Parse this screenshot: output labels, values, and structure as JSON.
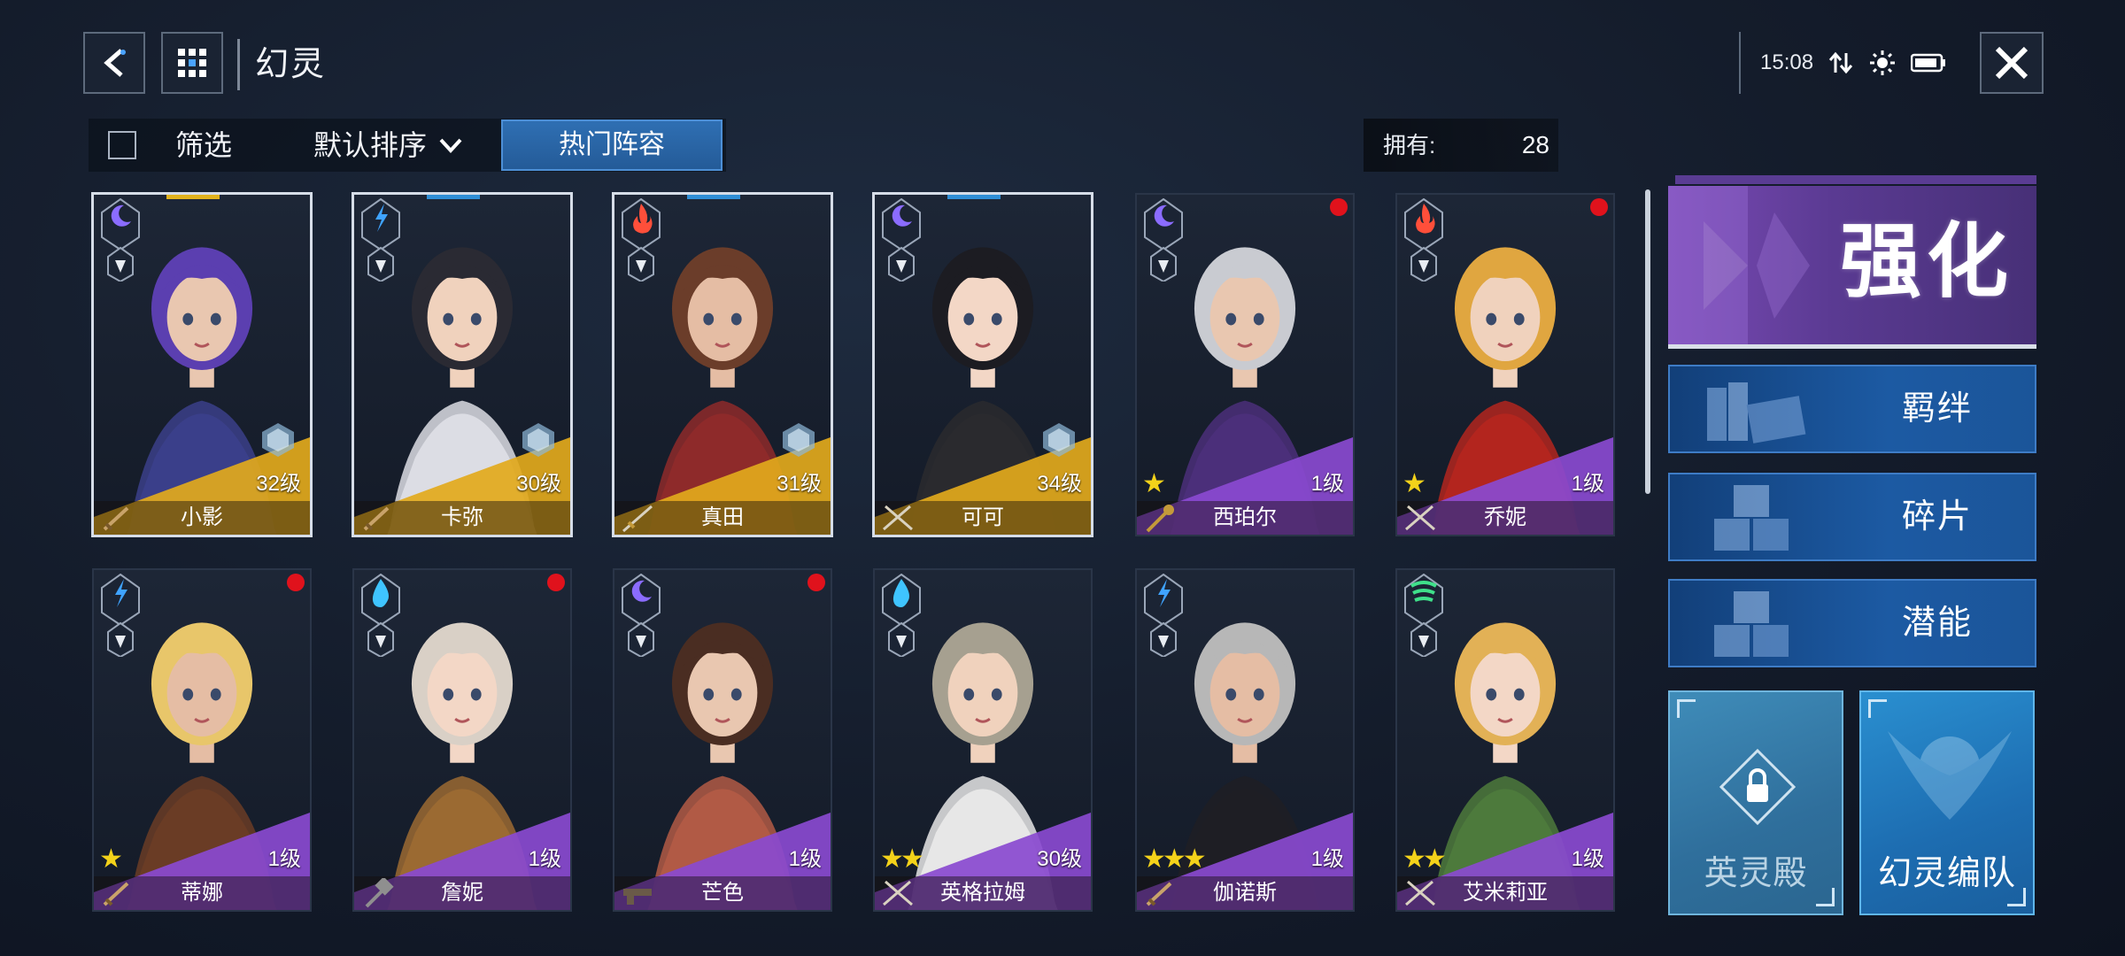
{
  "header": {
    "title": "幻灵",
    "back_icon": "back-arrow-icon",
    "grid_icon": "grid-menu-icon",
    "close_icon": "close-icon",
    "time": "15:08"
  },
  "toolbar": {
    "filter_label": "筛选",
    "sort_label": "默认排序",
    "hot_lineup_label": "热门阵容",
    "owned_label": "拥有:",
    "owned_count": "28"
  },
  "characters": [
    {
      "name": "小影",
      "level": "32级",
      "element": "moon",
      "weapon": "dagger",
      "stars": 0,
      "rarity": "gold",
      "selected": true,
      "alert": false,
      "accent": "#e2b21d"
    },
    {
      "name": "卡弥",
      "level": "30级",
      "element": "lightning",
      "weapon": "dagger",
      "stars": 0,
      "rarity": "gold",
      "selected": true,
      "alert": false,
      "accent": "#2f8ed6"
    },
    {
      "name": "真田",
      "level": "31级",
      "element": "fire",
      "weapon": "sword",
      "stars": 0,
      "rarity": "gold",
      "selected": true,
      "alert": false,
      "accent": "#2f8ed6"
    },
    {
      "name": "可可",
      "level": "34级",
      "element": "moon",
      "weapon": "crossed-swords",
      "stars": 0,
      "rarity": "gold",
      "selected": true,
      "alert": false,
      "accent": "#2f8ed6"
    },
    {
      "name": "西珀尔",
      "level": "1级",
      "element": "moon",
      "weapon": "mace",
      "stars": 1,
      "rarity": "purple",
      "selected": false,
      "alert": true,
      "accent": ""
    },
    {
      "name": "乔妮",
      "level": "1级",
      "element": "fire",
      "weapon": "crossed-swords",
      "stars": 1,
      "rarity": "purple",
      "selected": false,
      "alert": true,
      "accent": ""
    },
    {
      "name": "蒂娜",
      "level": "1级",
      "element": "lightning",
      "weapon": "dagger",
      "stars": 1,
      "rarity": "purple",
      "selected": false,
      "alert": true,
      "accent": ""
    },
    {
      "name": "詹妮",
      "level": "1级",
      "element": "water",
      "weapon": "hammer",
      "stars": 0,
      "rarity": "purple",
      "selected": false,
      "alert": true,
      "accent": ""
    },
    {
      "name": "芒色",
      "level": "1级",
      "element": "moon",
      "weapon": "gun",
      "stars": 0,
      "rarity": "purple",
      "selected": false,
      "alert": true,
      "accent": ""
    },
    {
      "name": "英格拉姆",
      "level": "30级",
      "element": "water",
      "weapon": "crossed-swords",
      "stars": 2,
      "rarity": "purple",
      "selected": false,
      "alert": false,
      "accent": ""
    },
    {
      "name": "伽诺斯",
      "level": "1级",
      "element": "lightning",
      "weapon": "dagger",
      "stars": 3,
      "rarity": "purple",
      "selected": false,
      "alert": false,
      "accent": ""
    },
    {
      "name": "艾米莉亚",
      "level": "1级",
      "element": "wind",
      "weapon": "crossed-swords",
      "stars": 2,
      "rarity": "purple",
      "selected": false,
      "alert": false,
      "accent": ""
    }
  ],
  "side_menu": {
    "enhance_label": "强化",
    "bond_label": "羁绊",
    "fragment_label": "碎片",
    "potential_label": "潜能",
    "hall_label": "英灵殿",
    "formation_label": "幻灵编队"
  },
  "colors": {
    "gold": "#e2a91c",
    "purple": "#8a4ad0",
    "alert": "#e0121c",
    "accent_blue": "#2f6fb3"
  }
}
